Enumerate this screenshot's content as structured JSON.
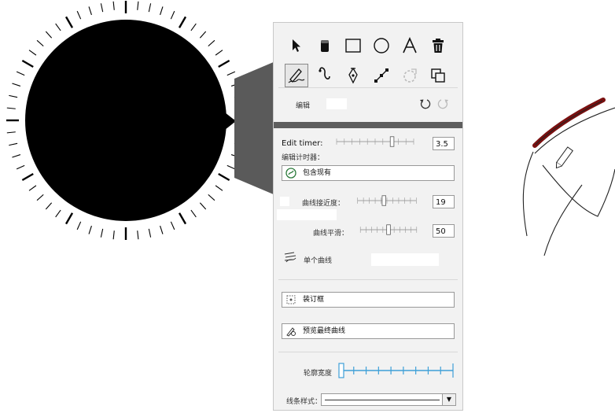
{
  "toolbar": {
    "tools": [
      {
        "name": "select"
      },
      {
        "name": "eraser"
      },
      {
        "name": "rectangle"
      },
      {
        "name": "ellipse"
      },
      {
        "name": "text"
      },
      {
        "name": "delete"
      },
      {
        "name": "freehand-sketch",
        "selected": true
      },
      {
        "name": "curve"
      },
      {
        "name": "pen"
      },
      {
        "name": "line"
      },
      {
        "name": "smart-fill"
      },
      {
        "name": "arrange"
      }
    ]
  },
  "edit": {
    "label": "编辑"
  },
  "timer": {
    "label": "Edit timer:",
    "sublabel": "编辑计时器：",
    "value": "3.5",
    "level": 0.72
  },
  "include_existing": {
    "label": "包含现有"
  },
  "proximity": {
    "label": "曲线接近度：",
    "value": "19",
    "level": 0.45
  },
  "smoothing": {
    "label": "曲线平滑：",
    "value": "50",
    "level": 0.5
  },
  "single_curve": {
    "label": "单个曲线"
  },
  "bounding_box": {
    "label": "装订框"
  },
  "preview": {
    "label": "预览最终曲线"
  },
  "outline": {
    "label": "轮廓宽度"
  },
  "line_style": {
    "label": "线条样式："
  },
  "colors": {
    "panel_bg": "#f2f2f2",
    "dark_bar": "#5e5e5e",
    "accent_blue": "#3ea0d8",
    "stroke_red": "#7a1010"
  }
}
